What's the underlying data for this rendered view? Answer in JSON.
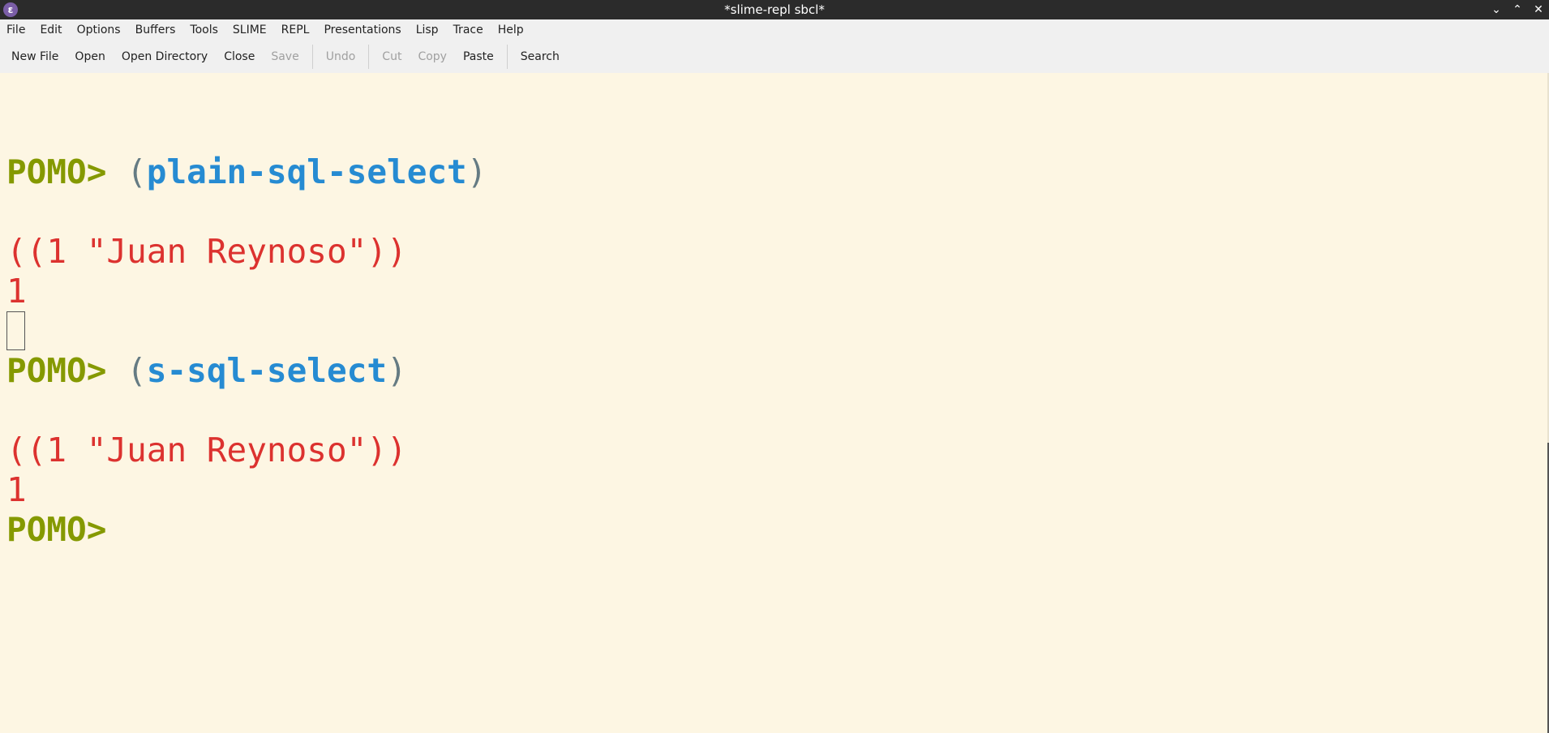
{
  "window": {
    "title": "*slime-repl sbcl*",
    "app_icon": "emacs-icon",
    "controls": [
      "minimize",
      "maximize",
      "close"
    ]
  },
  "menu": [
    "File",
    "Edit",
    "Options",
    "Buffers",
    "Tools",
    "SLIME",
    "REPL",
    "Presentations",
    "Lisp",
    "Trace",
    "Help"
  ],
  "toolbar": {
    "new_file": "New File",
    "open": "Open",
    "open_directory": "Open Directory",
    "close": "Close",
    "save": "Save",
    "undo": "Undo",
    "cut": "Cut",
    "copy": "Copy",
    "paste": "Paste",
    "search": "Search"
  },
  "repl": {
    "prompt": "POMO>",
    "entries": [
      {
        "open_paren": "(",
        "command": "plain-sql-select",
        "close_paren": ")",
        "result": "((1 \"Juan Reynoso\"))",
        "count": "1"
      },
      {
        "open_paren": "(",
        "command": "s-sql-select",
        "close_paren": ")",
        "result": "((1 \"Juan Reynoso\"))",
        "count": "1"
      }
    ]
  },
  "colors": {
    "background": "#fdf6e3",
    "prompt": "#859900",
    "function": "#268bd2",
    "result": "#dc322f",
    "paren": "#657b83"
  }
}
